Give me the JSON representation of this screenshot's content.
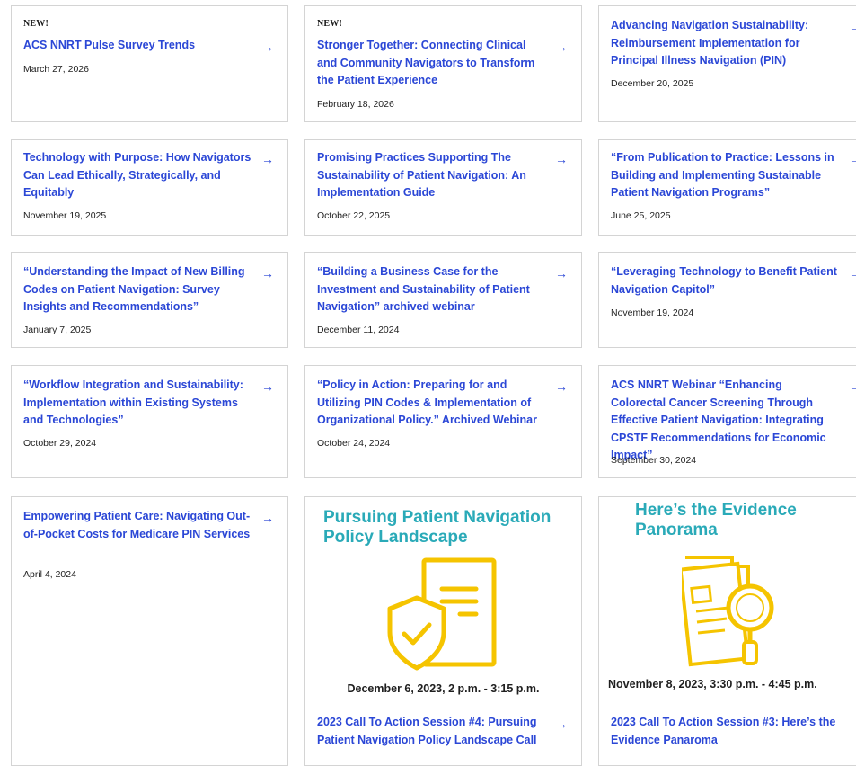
{
  "new_label": "NEW!",
  "arrow_glyph": "→",
  "accent_color": "#2b47d6",
  "promo_color": "#2aaab8",
  "icon_color": "#f5c400",
  "cards": [
    {
      "title": "ACS NNRT Pulse Survey Trends",
      "date": "March 27, 2026",
      "is_new": true
    },
    {
      "title": "Stronger Together: Connecting Clinical and Community Navigators to Transform the Patient Experience",
      "date": "February 18, 2026",
      "is_new": true
    },
    {
      "title": "Advancing Navigation Sustainability: Reimbursement Implementation for Principal Illness Navigation (PIN)",
      "date": "December 20, 2025"
    },
    {
      "title": "Technology with Purpose: How Navigators Can Lead Ethically, Strategically, and Equitably",
      "date": "November 19, 2025"
    },
    {
      "title": "Promising Practices Supporting The Sustainability of Patient Navigation: An Implementation Guide",
      "date": "October 22, 2025"
    },
    {
      "title": "“From Publication to Practice: Lessons in Building and Implementing Sustainable Patient Navigation Programs”",
      "date": "June 25, 2025"
    },
    {
      "title": "“Understanding the Impact of New Billing Codes on Patient Navigation: Survey Insights and Recommendations”",
      "date": "January 7, 2025"
    },
    {
      "title": "“Building a Business Case for the Investment and Sustainability of Patient Navigation” archived webinar",
      "date": "December 11, 2024"
    },
    {
      "title": "“Leveraging Technology to Benefit Patient Navigation Capitol”",
      "date": "November 19, 2024"
    },
    {
      "title": "“Workflow Integration and Sustainability: Implementation within Existing Systems and Technologies”",
      "date": "October 29, 2024"
    },
    {
      "title": "“Policy in Action: Preparing for and Utilizing PIN Codes & Implementation of Organizational Policy.” Archived Webinar",
      "date": "October 24, 2024"
    },
    {
      "title": "ACS NNRT Webinar “Enhancing Colorectal Cancer Screening Through Effective Patient Navigation: Integrating CPSTF Recommendations for Economic Impact”",
      "date": "September 30, 2024"
    },
    {
      "title": "Empowering Patient Care: Navigating Out-of-Pocket Costs for Medicare PIN Services",
      "date": "April 4, 2024"
    }
  ],
  "promos": [
    {
      "heading": "Pursuing Patient Navigation Policy Landscape",
      "event_date": "December 6, 2023, 2 p.m. - 3:15 p.m.",
      "title": "2023 Call To Action Session #4: Pursuing Patient Navigation Policy Landscape Call",
      "icon": "document-shield-check-icon"
    },
    {
      "heading": "Here’s the Evidence Panorama",
      "event_date": "November 8, 2023, 3:30 p.m. - 4:45 p.m.",
      "title": "2023 Call To Action Session #3: Here’s the Evidence Panaroma",
      "icon": "document-magnifier-icon"
    }
  ]
}
